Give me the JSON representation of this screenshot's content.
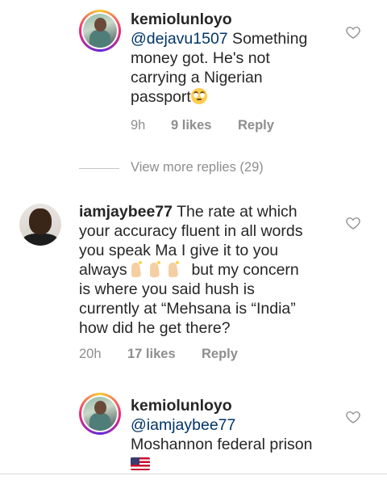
{
  "comments": [
    {
      "username": "kemiolunloyo",
      "mention": "@dejavu1507",
      "line1_rest": " Something",
      "line2": "money got. He's not",
      "line3": "carrying a Nigerian",
      "line4": "passport",
      "emoji": "face-with-rolling-eyes",
      "time": "9h",
      "likes": "9 likes",
      "reply": "Reply"
    },
    {
      "username": "iamjaybee77",
      "line1_rest": " The rate at which",
      "line2": "your accuracy fluent in all words",
      "line3": "you speak Ma I give it to you",
      "line4a": "always ",
      "line4b": " but my concern",
      "line5": "is where you said hush is",
      "line6": "currently at “Mehsana is “India”",
      "line7": "how did he get there?",
      "emoji": "raising-hands x3",
      "time": "20h",
      "likes": "17 likes",
      "reply": "Reply"
    },
    {
      "username": "kemiolunloyo",
      "mention": "@iamjaybee77",
      "line2": "Moshannon federal prison",
      "emoji": "flag-united-states"
    }
  ],
  "view_more": "View more replies (29)",
  "colors": {
    "text": "#262626",
    "meta": "#8e8e8e",
    "mention": "#003569",
    "story_ring": [
      "#f9ce34",
      "#ee2a7b",
      "#6228d7"
    ]
  }
}
